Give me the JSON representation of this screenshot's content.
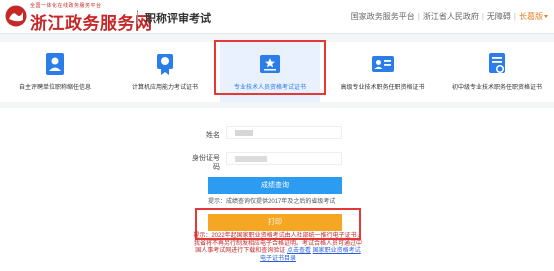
{
  "header": {
    "logo_small": "全国一体化在线政务服务平台",
    "logo_main": "浙江政务服务网",
    "page_title": "职称评审考试",
    "links": [
      "国家政务服务平台",
      "浙江省人民政府",
      "无障碍"
    ],
    "region": "长葛版"
  },
  "categories": [
    {
      "label": "自主评聘单位职称缩任信息",
      "icon": "person-badge-icon"
    },
    {
      "label": "计算机应用能力考试证书",
      "icon": "award-medal-icon"
    },
    {
      "label": "专业技术人员资格考试证书",
      "icon": "certificate-star-icon",
      "active": true
    },
    {
      "label": "高级专业技术职务任职资格证书",
      "icon": "id-card-icon"
    },
    {
      "label": "初中级专业技术职务任职资格证书",
      "icon": "document-seal-icon"
    }
  ],
  "form": {
    "name_label": "姓名",
    "id_label": "身份证号码",
    "query_button": "成绩查询",
    "hint": "提示：成绩查询仅提供2017年及之后的省级考试",
    "orange_button": "打印",
    "notice_text": "提示：2022年起国家职业资格考试由人社部统一推行电子证书，我省将不再另行制发相应电子合格证明。考试合格人员可通过中国人事考试网进行下载和查询验证",
    "notice_link_1": "点击查看",
    "notice_link_2": "国家职业资格考试电子证书目录"
  },
  "colors": {
    "brand_red": "#c62828",
    "accent_blue": "#2b9cf2",
    "accent_orange": "#f5a623",
    "highlight_red": "#e53935"
  }
}
